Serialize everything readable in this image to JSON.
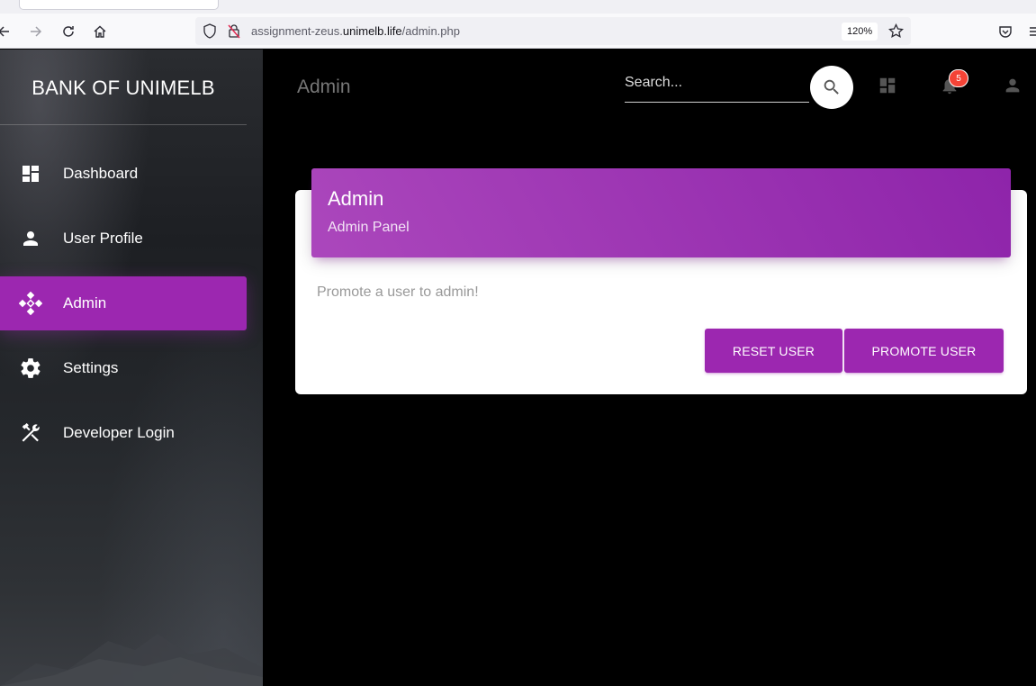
{
  "browser": {
    "url_prefix": "assignment-zeus.",
    "url_domain": "unimelb.life",
    "url_path": "/admin.php",
    "zoom": "120%"
  },
  "sidebar": {
    "brand": "BANK OF UNIMELB",
    "items": [
      {
        "label": "Dashboard",
        "icon": "dashboard-icon"
      },
      {
        "label": "User Profile",
        "icon": "person-icon"
      },
      {
        "label": "Admin",
        "icon": "admin-diamond-icon",
        "active": true
      },
      {
        "label": "Settings",
        "icon": "gear-icon"
      },
      {
        "label": "Developer Login",
        "icon": "tools-icon"
      }
    ]
  },
  "header": {
    "title": "Admin",
    "search_placeholder": "Search...",
    "notification_count": "5"
  },
  "card": {
    "title": "Admin",
    "subtitle": "Admin Panel",
    "body": "Promote a user to admin!",
    "reset_label": "RESET USER",
    "promote_label": "PROMOTE USER"
  },
  "colors": {
    "accent": "#9c27b0",
    "badge": "#f44336"
  }
}
